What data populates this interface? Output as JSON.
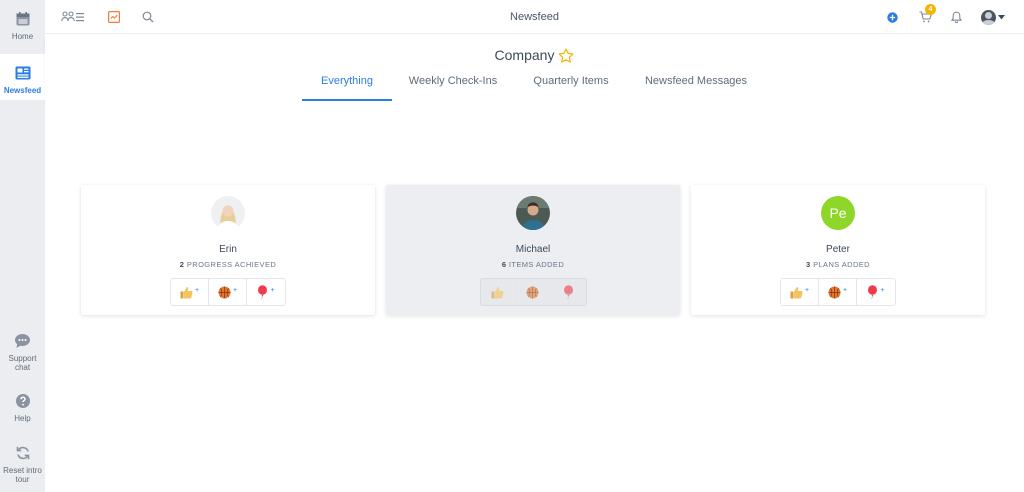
{
  "sidebar": {
    "items": [
      {
        "label": "Home",
        "icon": "calendar-icon"
      },
      {
        "label": "Newsfeed",
        "icon": "newsfeed-icon",
        "active": true
      },
      {
        "label": "Support chat",
        "icon": "chat-icon"
      },
      {
        "label": "Help",
        "icon": "help-icon"
      },
      {
        "label": "Reset intro tour",
        "icon": "reset-icon"
      }
    ]
  },
  "topbar": {
    "title": "Newsfeed",
    "cart_count": "4"
  },
  "header": {
    "company": "Company",
    "tabs": [
      {
        "label": "Everything",
        "active": true
      },
      {
        "label": "Weekly Check-Ins"
      },
      {
        "label": "Quarterly Items"
      },
      {
        "label": "Newsfeed Messages"
      }
    ]
  },
  "cards": [
    {
      "name": "Erin",
      "count": "2",
      "stat": "PROGRESS ACHIEVED"
    },
    {
      "name": "Michael",
      "count": "6",
      "stat": "ITEMS ADDED"
    },
    {
      "name": "Peter",
      "count": "3",
      "stat": "PLANS ADDED",
      "initials": "Pe"
    }
  ],
  "colors": {
    "accent": "#2a7de1",
    "sidebar_bg": "#ebedf0",
    "avatar_green": "#8fd62a",
    "badge": "#f5b400",
    "star": "#f5b400"
  }
}
